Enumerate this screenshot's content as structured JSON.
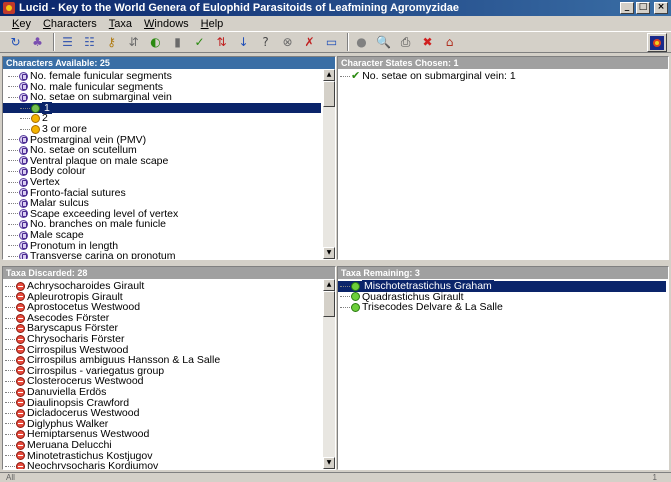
{
  "window": {
    "title": "Lucid - Key to the World Genera of Eulophid Parasitoids of Leafmining Agromyzidae",
    "min_label": "_",
    "max_label": "□",
    "close_label": "×"
  },
  "menu": [
    {
      "id": "key",
      "ul": "K",
      "rest": "ey"
    },
    {
      "id": "characters",
      "ul": "C",
      "rest": "haracters"
    },
    {
      "id": "taxa",
      "ul": "T",
      "rest": "axa"
    },
    {
      "id": "windows",
      "ul": "W",
      "rest": "indows"
    },
    {
      "id": "help",
      "ul": "H",
      "rest": "elp"
    }
  ],
  "toolbar": [
    {
      "icon": "refresh-icon",
      "glyph": "↻",
      "color": "#1f4fb8"
    },
    {
      "icon": "group-icon",
      "glyph": "♣",
      "color": "#7a4fb0"
    },
    {
      "icon": "list-tree-icon",
      "glyph": "☰",
      "color": "#3a5ab0"
    },
    {
      "icon": "list-icon",
      "glyph": "☷",
      "color": "#3a5ab0"
    },
    {
      "icon": "key-icon",
      "glyph": "⚷",
      "color": "#b07a10"
    },
    {
      "icon": "sort-icon",
      "glyph": "⇵",
      "color": "#6a6a6a"
    },
    {
      "icon": "best-icon",
      "glyph": "◐",
      "color": "#2a8a10"
    },
    {
      "icon": "chart-icon",
      "glyph": "▮",
      "color": "#6a6a6a"
    },
    {
      "icon": "check-icon",
      "glyph": "✓",
      "color": "#2a8a10"
    },
    {
      "icon": "az-sort-icon",
      "glyph": "⇅",
      "color": "#c02020"
    },
    {
      "icon": "order-icon",
      "glyph": "↓",
      "color": "#1f4fb8"
    },
    {
      "icon": "unknown-icon",
      "glyph": "?",
      "color": "#4a4a4a"
    },
    {
      "icon": "filter-icon",
      "glyph": "⊗",
      "color": "#6a6a6a"
    },
    {
      "icon": "checklist-icon",
      "glyph": "✗",
      "color": "#c02020"
    },
    {
      "icon": "window-icon",
      "glyph": "▭",
      "color": "#1f4fb8"
    },
    {
      "icon": "circle-icon",
      "glyph": "●",
      "color": "#808080"
    },
    {
      "icon": "find-icon",
      "glyph": "🔍",
      "color": "#1f4fb8"
    },
    {
      "icon": "print-icon",
      "glyph": "⎙",
      "color": "#4a4a4a"
    },
    {
      "icon": "stop-icon",
      "glyph": "✖",
      "color": "#d02020"
    },
    {
      "icon": "home-icon",
      "glyph": "⌂",
      "color": "#b03020"
    }
  ],
  "panels": {
    "characters_available": {
      "title": "Characters Available: 25",
      "rows": [
        {
          "type": "char",
          "label": "No. female funicular segments"
        },
        {
          "type": "char",
          "label": "No. male funicular segments"
        },
        {
          "type": "char",
          "label": "No. setae on submarginal vein"
        },
        {
          "type": "state-first",
          "label": "1",
          "selected": true
        },
        {
          "type": "state",
          "label": "2"
        },
        {
          "type": "state",
          "label": "3 or more"
        },
        {
          "type": "char",
          "label": "Postmarginal vein (PMV)"
        },
        {
          "type": "char",
          "label": "No. setae on scutellum"
        },
        {
          "type": "char",
          "label": "Ventral plaque on male scape"
        },
        {
          "type": "char",
          "label": "Body colour"
        },
        {
          "type": "char",
          "label": "Vertex"
        },
        {
          "type": "char",
          "label": "Fronto-facial sutures"
        },
        {
          "type": "char",
          "label": "Malar sulcus"
        },
        {
          "type": "char",
          "label": "Scape exceeding level of vertex"
        },
        {
          "type": "char",
          "label": "No. branches on male funicle"
        },
        {
          "type": "char",
          "label": "Male scape"
        },
        {
          "type": "char",
          "label": "Pronotum in length"
        },
        {
          "type": "char",
          "label": "Transverse carina on pronotum"
        }
      ]
    },
    "states_chosen": {
      "title": "Character States Chosen: 1",
      "rows": [
        {
          "label": "No. setae on submarginal vein: 1"
        }
      ]
    },
    "taxa_discarded": {
      "title": "Taxa Discarded: 28",
      "rows": [
        "Achrysocharoides Girault",
        "Apleurotropis Girault",
        "Aprostocetus Westwood",
        "Asecodes Förster",
        "Baryscapus Förster",
        "Chrysocharis Förster",
        "Cirrospilus Westwood",
        "Cirrospilus ambiguus Hansson & La Salle",
        "Cirrospilus - variegatus group",
        "Closterocerus Westwood",
        "Danuviella Erdös",
        "Diaulinopsis Crawford",
        "Dicladocerus Westwood",
        "Diglyphus Walker",
        "Hemiptarsenus Westwood",
        "Meruana Delucchi",
        "Minotetrastichus Kostjugov",
        "Neochrysocharis Kordjumov"
      ]
    },
    "taxa_remaining": {
      "title": "Taxa Remaining: 3",
      "rows": [
        {
          "label": "Mischotetrastichus Graham",
          "selected": true
        },
        {
          "label": "Quadrastichus Girault",
          "selected": false
        },
        {
          "label": "Trisecodes Delvare & La Salle",
          "selected": false
        }
      ]
    }
  },
  "status": {
    "left": "All",
    "right": "1"
  }
}
